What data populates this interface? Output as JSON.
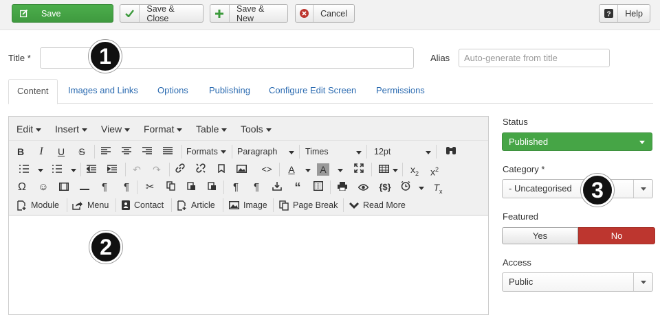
{
  "toolbar": {
    "save_label": "Save",
    "save_close_label": "Save & Close",
    "save_new_label": "Save & New",
    "cancel_label": "Cancel",
    "help_label": "Help"
  },
  "form": {
    "title_label": "Title *",
    "title_value": "",
    "alias_label": "Alias",
    "alias_placeholder": "Auto-generate from title"
  },
  "markers": [
    "1",
    "2",
    "3"
  ],
  "tabs": [
    "Content",
    "Images and Links",
    "Options",
    "Publishing",
    "Configure Edit Screen",
    "Permissions"
  ],
  "editor": {
    "menus": [
      "Edit",
      "Insert",
      "View",
      "Format",
      "Table",
      "Tools"
    ],
    "formats_label": "Formats",
    "block_format": "Paragraph",
    "font_family": "Times",
    "font_size": "12pt",
    "insert_buttons": [
      "Module",
      "Menu",
      "Contact",
      "Article",
      "Image",
      "Page Break",
      "Read More"
    ]
  },
  "sidebar": {
    "status_label": "Status",
    "status_value": "Published",
    "category_label": "Category *",
    "category_value": "- Uncategorised",
    "featured_label": "Featured",
    "featured_yes": "Yes",
    "featured_no": "No",
    "access_label": "Access",
    "access_value": "Public"
  },
  "colors": {
    "save_green": "#46a546",
    "no_red": "#bd362f",
    "link_blue": "#2a6ab0"
  }
}
